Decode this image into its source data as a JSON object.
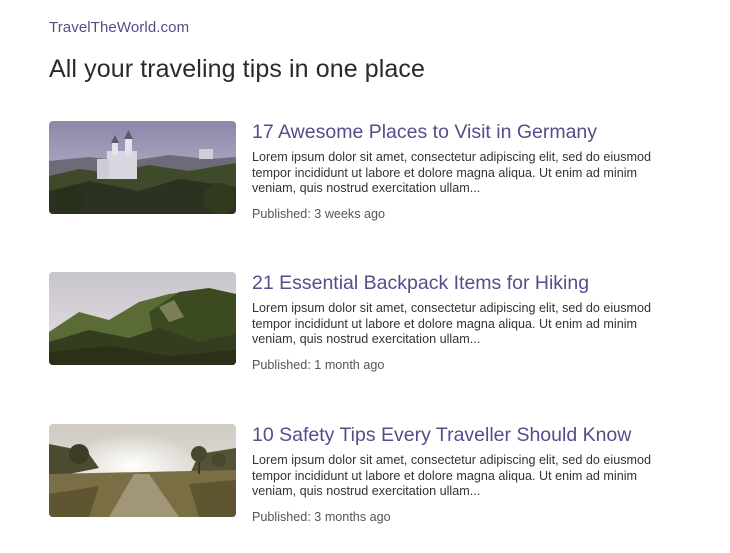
{
  "site": {
    "name": "TravelTheWorld.com"
  },
  "page": {
    "title": "All your traveling tips in one place"
  },
  "articles": [
    {
      "title": "17 Awesome Places to Visit in Germany",
      "excerpt": "Lorem ipsum dolor sit amet, consectetur adipiscing elit, sed do eiusmod tempor incididunt ut labore et dolore magna aliqua. Ut enim ad minim veniam, quis nostrud exercitation ullam...",
      "published": "Published: 3 weeks ago",
      "image": "castle-photo"
    },
    {
      "title": "21 Essential Backpack Items for Hiking",
      "excerpt": "Lorem ipsum dolor sit amet, consectetur adipiscing elit, sed do eiusmod tempor incididunt ut labore et dolore magna aliqua. Ut enim ad minim veniam, quis nostrud exercitation ullam...",
      "published": "Published: 1 month ago",
      "image": "green-cliffs-photo"
    },
    {
      "title": "10 Safety Tips Every Traveller Should Know",
      "excerpt": "Lorem ipsum dolor sit amet, consectetur adipiscing elit, sed do eiusmod tempor incididunt ut labore et dolore magna aliqua. Ut enim ad minim veniam, quis nostrud exercitation ullam...",
      "published": "Published: 3 months ago",
      "image": "countryside-path-photo"
    }
  ],
  "colors": {
    "accent": "#5b4a8a",
    "text": "#333333",
    "background": "#ffffff"
  }
}
